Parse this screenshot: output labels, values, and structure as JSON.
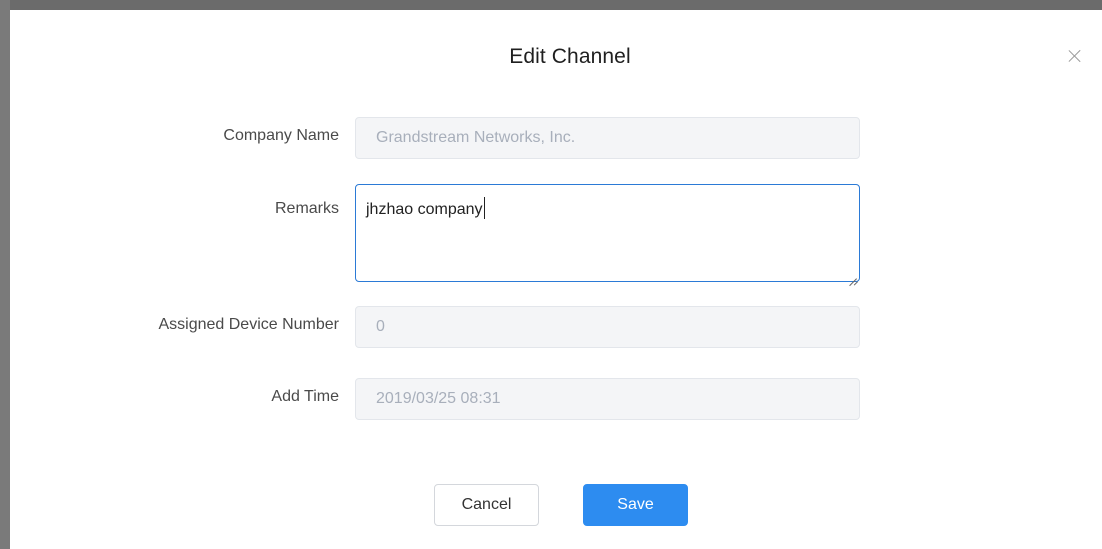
{
  "modal": {
    "title": "Edit Channel"
  },
  "form": {
    "company_name": {
      "label": "Company Name",
      "value": "Grandstream Networks, Inc."
    },
    "remarks": {
      "label": "Remarks",
      "value": "jhzhao company"
    },
    "assigned_device_number": {
      "label": "Assigned Device Number",
      "value": "0"
    },
    "add_time": {
      "label": "Add Time",
      "value": "2019/03/25 08:31"
    }
  },
  "buttons": {
    "cancel_label": "Cancel",
    "save_label": "Save"
  },
  "icons": {
    "close": "close-icon"
  },
  "colors": {
    "primary": "#2d8cf0",
    "focus_border": "#2b7ad6",
    "disabled_bg": "#f4f5f7",
    "disabled_text": "#a8afbb"
  }
}
